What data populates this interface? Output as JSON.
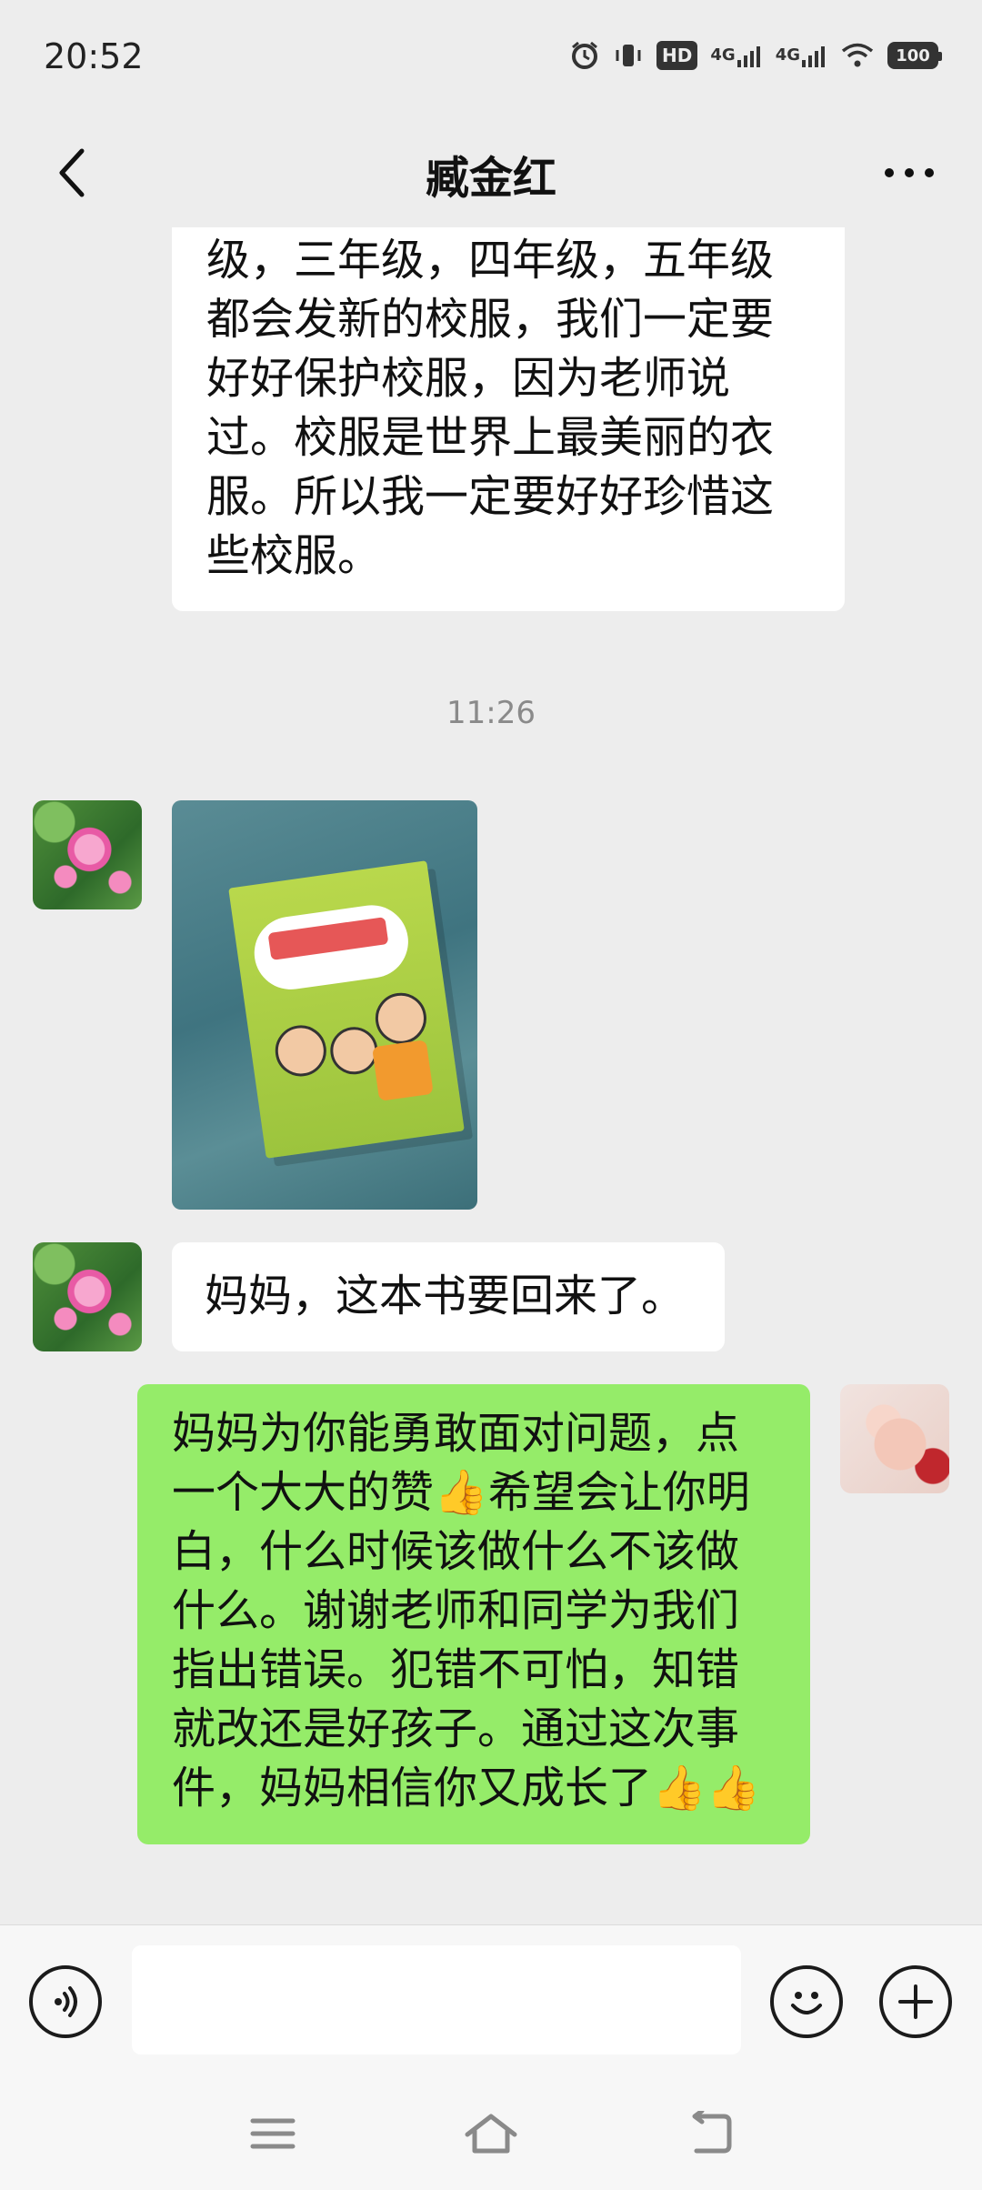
{
  "status_bar": {
    "time": "20:52",
    "hd_label": "HD",
    "sim1_label": "4G",
    "sim2_label": "4G",
    "battery_level": "100"
  },
  "nav": {
    "title": "臧金红"
  },
  "messages": {
    "incoming_text_1": "级，三年级，四年级，五年级\n都会发新的校服，我们一定要\n好好保护校服，因为老师说\n过。校服是世界上最美丽的衣\n服。所以我一定要好好珍惜这\n些校服。",
    "timestamp": "11:26",
    "incoming_text_2": "妈妈，这本书要回来了。",
    "outgoing_text_1": "妈妈为你能勇敢面对问题，点\n一个大大的赞👍希望会让你明\n白，什么时候该做什么不该做\n什么。谢谢老师和同学为我们\n指出错误。犯错不可怕，知错\n就改还是好孩子。通过这次事\n件，妈妈相信你又成长了👍👍"
  },
  "input": {
    "placeholder": ""
  },
  "colors": {
    "background": "#ededed",
    "incoming_bubble": "#ffffff",
    "outgoing_bubble": "#95ec69"
  }
}
